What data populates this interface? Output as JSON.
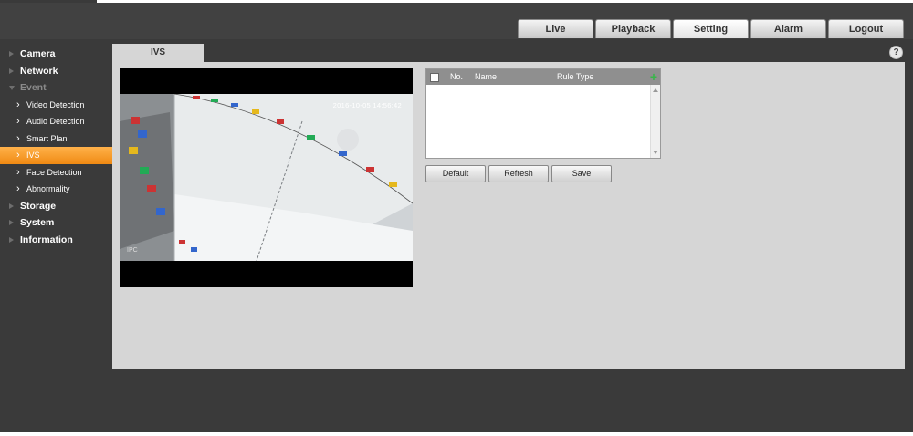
{
  "nav": {
    "tabs": [
      "Live",
      "Playback",
      "Setting",
      "Alarm",
      "Logout"
    ],
    "active_tab": "Setting"
  },
  "sidebar": {
    "items": [
      {
        "label": "Camera",
        "type": "section"
      },
      {
        "label": "Network",
        "type": "section"
      },
      {
        "label": "Event",
        "type": "section-open"
      },
      {
        "label": "Video Detection",
        "type": "sub"
      },
      {
        "label": "Audio Detection",
        "type": "sub"
      },
      {
        "label": "Smart Plan",
        "type": "sub"
      },
      {
        "label": "IVS",
        "type": "sub",
        "active": true
      },
      {
        "label": "Face Detection",
        "type": "sub"
      },
      {
        "label": "Abnormality",
        "type": "sub"
      },
      {
        "label": "Storage",
        "type": "section"
      },
      {
        "label": "System",
        "type": "section"
      },
      {
        "label": "Information",
        "type": "section"
      }
    ]
  },
  "content": {
    "tab_label": "IVS",
    "help_icon": "?",
    "video": {
      "timestamp": "2016-10-05 14:56:42",
      "channel_label": "IPC"
    },
    "rules_table": {
      "headers": {
        "no": "No.",
        "name": "Name",
        "rule_type": "Rule Type"
      },
      "add_icon": "+",
      "rows": []
    },
    "buttons": {
      "default": "Default",
      "refresh": "Refresh",
      "save": "Save"
    }
  },
  "colors": {
    "accent_active": "#f5961e",
    "add_icon": "#39b54a",
    "background": "#3a3a3a",
    "panel": "#d6d6d6"
  }
}
